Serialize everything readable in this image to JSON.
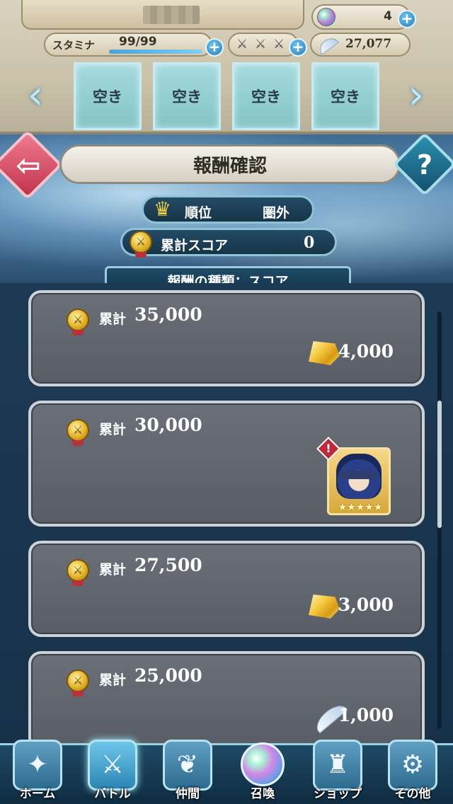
{
  "header": {
    "stamina_label": "スタミナ",
    "stamina_value": "99/99",
    "stamina_fill": 1.0,
    "orb_count": "4",
    "feather_count": "27,077"
  },
  "slots": [
    "空き",
    "空き",
    "空き",
    "空き"
  ],
  "page": {
    "title": "報酬確認"
  },
  "rank": {
    "label": "順位",
    "value": "圏外"
  },
  "score": {
    "label": "累計スコア",
    "value": "0"
  },
  "reward_type": "報酬の種類：スコア",
  "rewards": [
    {
      "label": "累計",
      "score": "35,000",
      "reward": "gem",
      "amount": "4,000"
    },
    {
      "label": "累計",
      "score": "30,000",
      "reward": "hero",
      "amount": ""
    },
    {
      "label": "累計",
      "score": "27,500",
      "reward": "gem",
      "amount": "3,000"
    },
    {
      "label": "累計",
      "score": "25,000",
      "reward": "feather",
      "amount": "1,000"
    }
  ],
  "nav": [
    {
      "label": "ホーム",
      "icon": "home-icon"
    },
    {
      "label": "バトル",
      "icon": "battle-icon"
    },
    {
      "label": "仲間",
      "icon": "allies-icon"
    },
    {
      "label": "召喚",
      "icon": "summon-orb-icon"
    },
    {
      "label": "ショップ",
      "icon": "shop-castle-icon"
    },
    {
      "label": "その他",
      "icon": "gear-icon"
    }
  ],
  "hero_stars": "★★★★★",
  "colors": {
    "accent": "#8fc3d6",
    "back_button": "#d04860",
    "help_button": "#1f7797"
  }
}
